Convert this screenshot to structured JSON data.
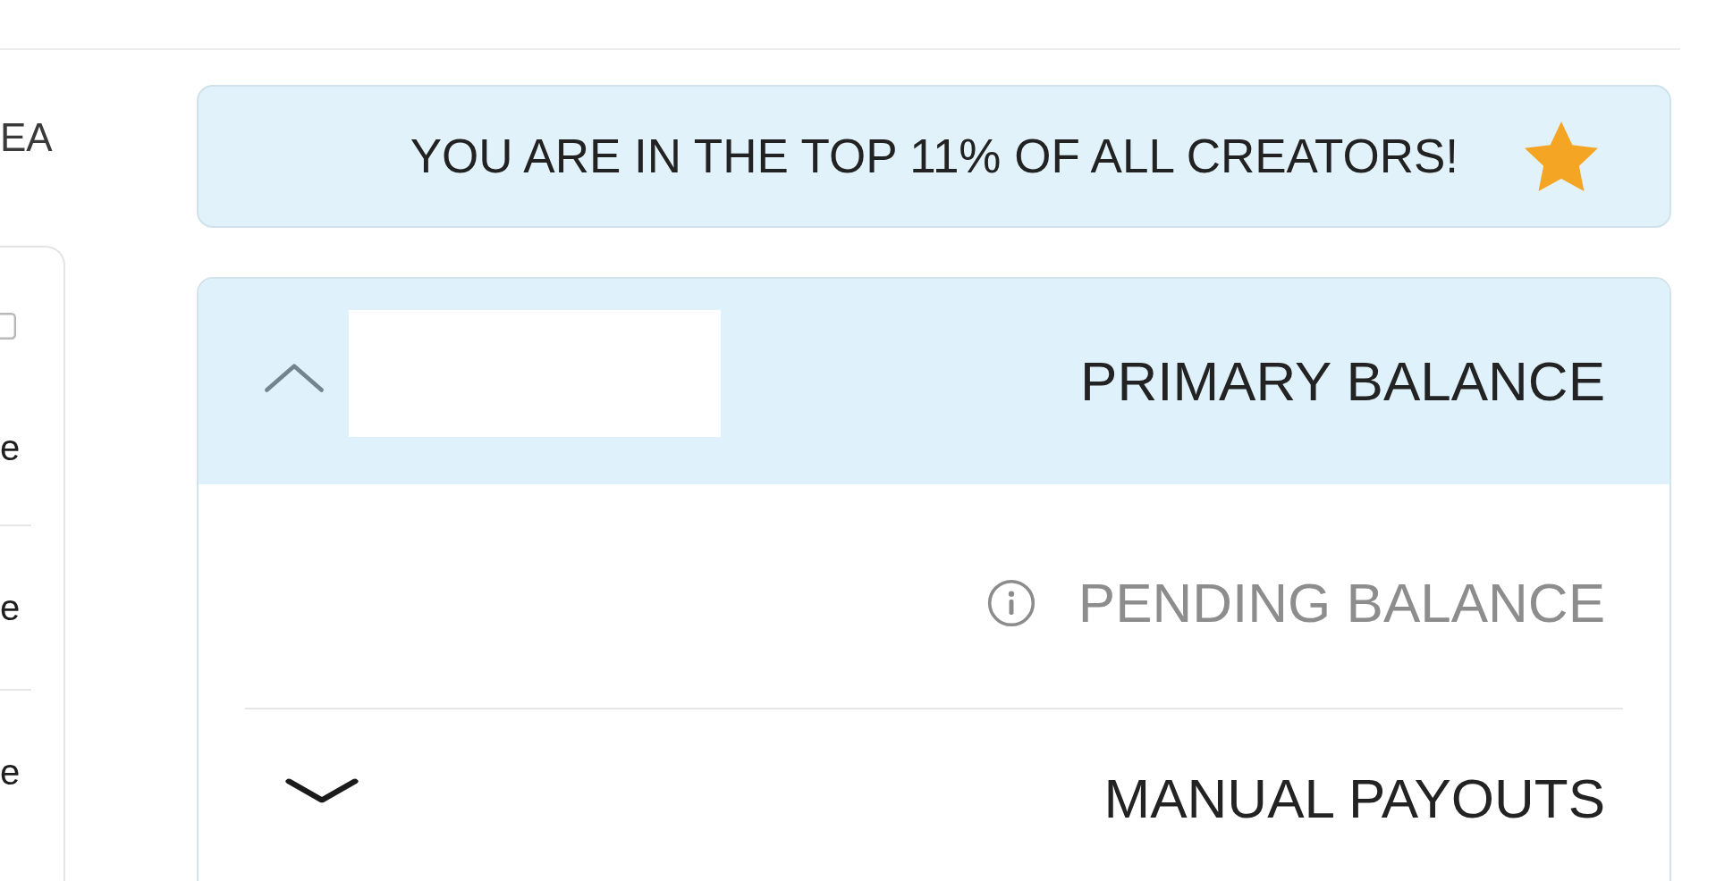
{
  "banner": {
    "text": "YOU ARE IN THE TOP 11% OF ALL CREATORS!"
  },
  "balance_card": {
    "header": {
      "title": "PRIMARY BALANCE",
      "expanded": true
    },
    "rows": [
      {
        "kind": "info",
        "label": "PENDING BALANCE"
      },
      {
        "kind": "collapsible",
        "label": "MANUAL PAYOUTS",
        "expanded": false
      }
    ]
  },
  "side_panel": {
    "title": "EA",
    "rows": [
      "e",
      "e",
      "e"
    ]
  }
}
